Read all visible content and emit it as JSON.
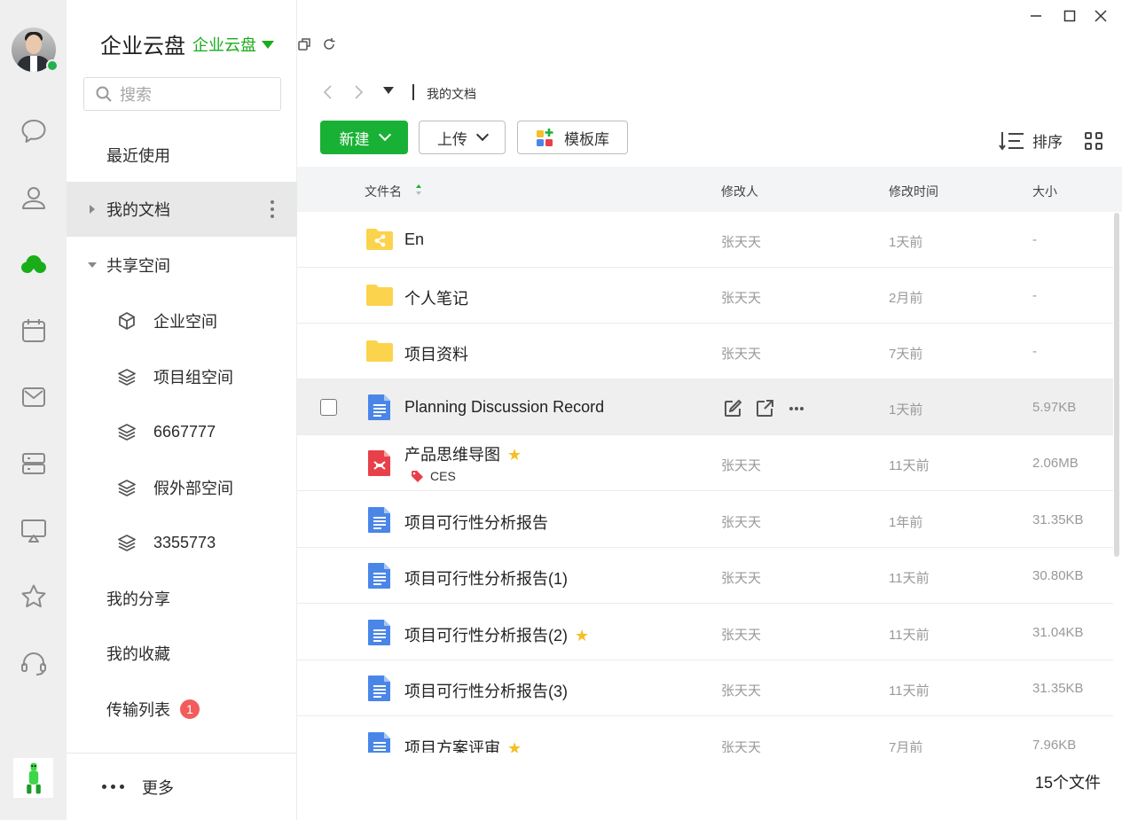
{
  "app": {
    "title": "企业云盘",
    "subtitle": "企业云盘"
  },
  "rail": {
    "icons": [
      "chat-icon",
      "contacts-icon",
      "cloud-icon",
      "calendar-icon",
      "mail-icon",
      "server-icon",
      "screen-share-icon",
      "star-icon",
      "headset-icon"
    ],
    "accent": "#1aad19"
  },
  "sidebar": {
    "search_placeholder": "搜索",
    "recent": "最近使用",
    "my_docs": "我的文档",
    "shared_space": "共享空间",
    "spaces": [
      "企业空间",
      "项目组空间",
      "6667777",
      "假外部空间",
      "3355773"
    ],
    "my_shares": "我的分享",
    "my_favorites": "我的收藏",
    "transfer_list": "传输列表",
    "transfer_badge": "1",
    "more": "更多"
  },
  "breadcrumb": {
    "current": "我的文档"
  },
  "toolbar": {
    "new_label": "新建",
    "upload_label": "上传",
    "template_label": "模板库",
    "sort_label": "排序"
  },
  "table": {
    "headers": {
      "name": "文件名",
      "modifier": "修改人",
      "mtime": "修改时间",
      "size": "大小"
    },
    "rows": [
      {
        "name": "En",
        "type": "shared-folder",
        "modifier": "张天天",
        "mtime": "1天前",
        "size": "-"
      },
      {
        "name": "个人笔记",
        "type": "folder",
        "modifier": "张天天",
        "mtime": "2月前",
        "size": "-"
      },
      {
        "name": "项目资料",
        "type": "folder",
        "modifier": "张天天",
        "mtime": "7天前",
        "size": "-"
      },
      {
        "name": "Planning Discussion Record",
        "type": "doc",
        "modifier": "",
        "mtime": "1天前",
        "size": "5.97KB"
      },
      {
        "name": "产品思维导图",
        "type": "mindmap",
        "modifier": "张天天",
        "mtime": "11天前",
        "size": "2.06MB",
        "tag": "CES",
        "starred": true
      },
      {
        "name": "项目可行性分析报告",
        "type": "doc",
        "modifier": "张天天",
        "mtime": "1年前",
        "size": "31.35KB"
      },
      {
        "name": "项目可行性分析报告(1)",
        "type": "doc",
        "modifier": "张天天",
        "mtime": "11天前",
        "size": "30.80KB"
      },
      {
        "name": "项目可行性分析报告(2)",
        "type": "doc",
        "modifier": "张天天",
        "mtime": "11天前",
        "size": "31.04KB",
        "starred": true
      },
      {
        "name": "项目可行性分析报告(3)",
        "type": "doc",
        "modifier": "张天天",
        "mtime": "11天前",
        "size": "31.35KB"
      },
      {
        "name": "项目方案评审",
        "type": "doc",
        "modifier": "张天天",
        "mtime": "7月前",
        "size": "7.96KB",
        "starred": true
      }
    ]
  },
  "footer": {
    "file_count": "15个文件"
  },
  "colors": {
    "green": "#19b135",
    "folder": "#fcd34d",
    "doc_blue": "#4a86e8",
    "mindmap_red": "#e8404a",
    "star": "#f5bf26",
    "badge_red": "#f25c5c"
  }
}
